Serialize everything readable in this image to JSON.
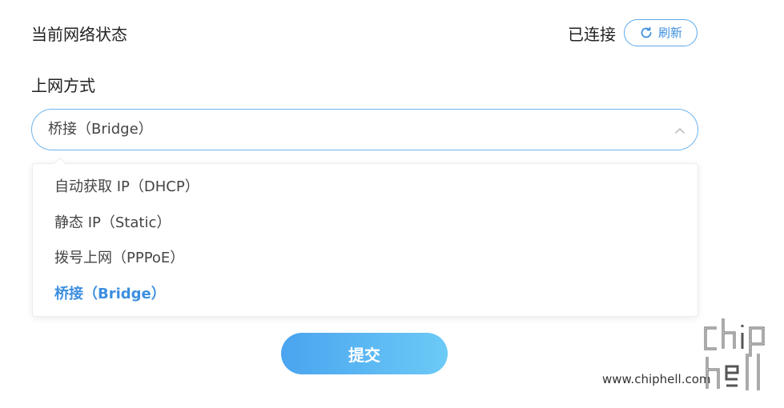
{
  "status": {
    "label": "当前网络状态",
    "value": "已连接",
    "refresh_label": "刷新"
  },
  "connection": {
    "title": "上网方式",
    "selected_value": "桥接（Bridge）",
    "options": [
      {
        "label": "自动获取 IP（DHCP）",
        "selected": false
      },
      {
        "label": "静态 IP（Static）",
        "selected": false
      },
      {
        "label": "拨号上网（PPPoE）",
        "selected": false
      },
      {
        "label": "桥接（Bridge）",
        "selected": true
      }
    ]
  },
  "submit_label": "提交",
  "watermark": {
    "site": "www.chiphell.com",
    "logo_text": "chip hell"
  },
  "colors": {
    "accent": "#3d8fe0",
    "border": "#6eb4ee",
    "button_start": "#4aa4ef",
    "button_end": "#6ccaf6"
  },
  "icons": {
    "refresh": "refresh-icon",
    "dropdown": "chevron-up-icon"
  }
}
